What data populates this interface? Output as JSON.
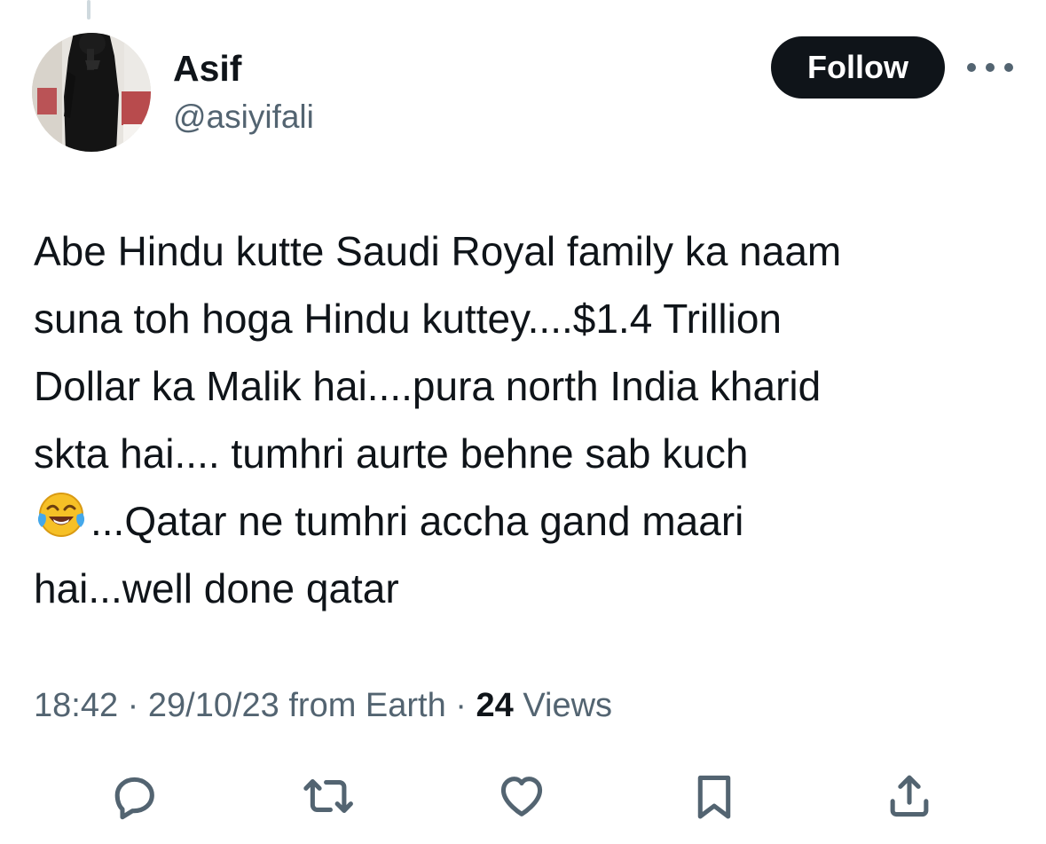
{
  "thread": {
    "connector": "thread-line"
  },
  "author": {
    "name": "Asif",
    "handle": "@asiyifali",
    "avatar_icon": "profile-photo"
  },
  "header": {
    "follow_label": "Follow",
    "more_icon": "more-horizontal-icon"
  },
  "tweet": {
    "lines": [
      "Abe Hindu kutte Saudi Royal family ka naam",
      "suna toh hoga Hindu kuttey....$1.4 Trillion",
      "Dollar ka Malik hai....pura north India kharid",
      "skta hai.... tumhri aurte behne sab kuch",
      "...Qatar ne tumhri accha gand maari",
      "hai...well done qatar"
    ],
    "emoji": "😂"
  },
  "meta": {
    "time": "18:42",
    "separator_1": " · ",
    "date": "29/10/23",
    "source": " from Earth",
    "separator_2": " · ",
    "views_count": "24",
    "views_label": " Views"
  },
  "actions": {
    "reply_icon": "reply-icon",
    "retweet_icon": "retweet-icon",
    "like_icon": "heart-icon",
    "bookmark_icon": "bookmark-icon",
    "share_icon": "share-icon"
  },
  "colors": {
    "text_primary": "#0f1419",
    "text_secondary": "#536471",
    "follow_button_bg": "#0f1419",
    "follow_button_text": "#ffffff",
    "thread_line": "#cfd9de"
  }
}
